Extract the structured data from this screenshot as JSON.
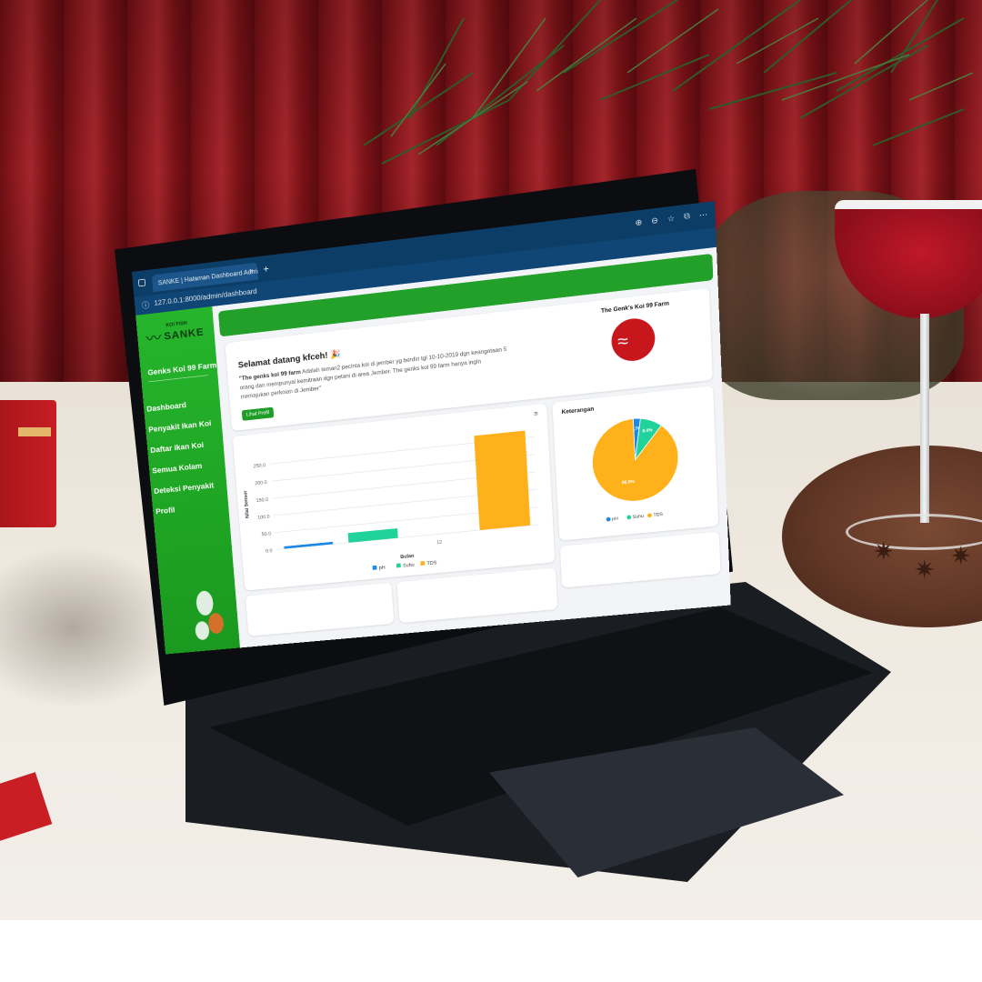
{
  "browser": {
    "tab_title": "SANKE | Halaman Dashboard Admin",
    "tab_close": "×",
    "new_tab": "+",
    "url": "127.0.0.1:8000/admin/dashboard",
    "tools": [
      "⊕",
      "⊖",
      "☆",
      "⧉",
      "⋯"
    ]
  },
  "sidebar": {
    "logo_small": "KOI FISH",
    "logo_big": "SANKE",
    "brand": "Genks Koi 99 Farm",
    "items": [
      {
        "label": "Dashboard"
      },
      {
        "label": "Penyakit Ikan Koi"
      },
      {
        "label": "Daftar Ikan Koi"
      },
      {
        "label": "Semua Kolam"
      },
      {
        "label": "Deteksi Penyakit"
      },
      {
        "label": "Profil"
      }
    ]
  },
  "welcome": {
    "title": "Selamat datang kfceh! 🎉",
    "text_bold": "\"The genks koi 99 farm",
    "text_rest": " Adalah teman2 pecinta koi di jember yg berdiri tgl 10-10-2019 dgn keangotaan 5 orang dan mempunyai kemitraan dgn petani di area Jember. The genks koi 99 farm hanya ingin memajukan perkoian di Jember\"",
    "button": "Lihat Profil",
    "farm_title": "The Genk's Koi 99 Farm"
  },
  "colors": {
    "sidebar_green": "#26b52c",
    "topbar_green": "#23a02a",
    "ph": "#1e88e5",
    "suhu": "#20d39a",
    "tds": "#ffb11b"
  },
  "chart_data": [
    {
      "type": "bar",
      "categories": [
        "",
        "",
        "12",
        ""
      ],
      "series": [
        {
          "name": "pH",
          "values": [
            7,
            0,
            0,
            0
          ]
        },
        {
          "name": "Suhu",
          "values": [
            0,
            28,
            0,
            0
          ]
        },
        {
          "name": "TDS",
          "values": [
            0,
            0,
            0,
            270
          ]
        }
      ],
      "xlabel": "Bulan",
      "ylabel": "Nilai Sensor",
      "yticks": [
        "0.0",
        "50.0",
        "100.0",
        "150.0",
        "200.0",
        "250.0"
      ],
      "ylim": [
        0,
        280
      ],
      "legend": "bottom",
      "grid": true,
      "menu_icon": "≡"
    },
    {
      "type": "pie",
      "title": "Keterangan",
      "labels": [
        "pH",
        "Suhu",
        "TDS"
      ],
      "values": [
        2.7,
        8.4,
        88.9
      ],
      "data_labels": [
        "2.7%",
        "8.4%",
        "88.9%"
      ],
      "legend": "bottom"
    }
  ]
}
